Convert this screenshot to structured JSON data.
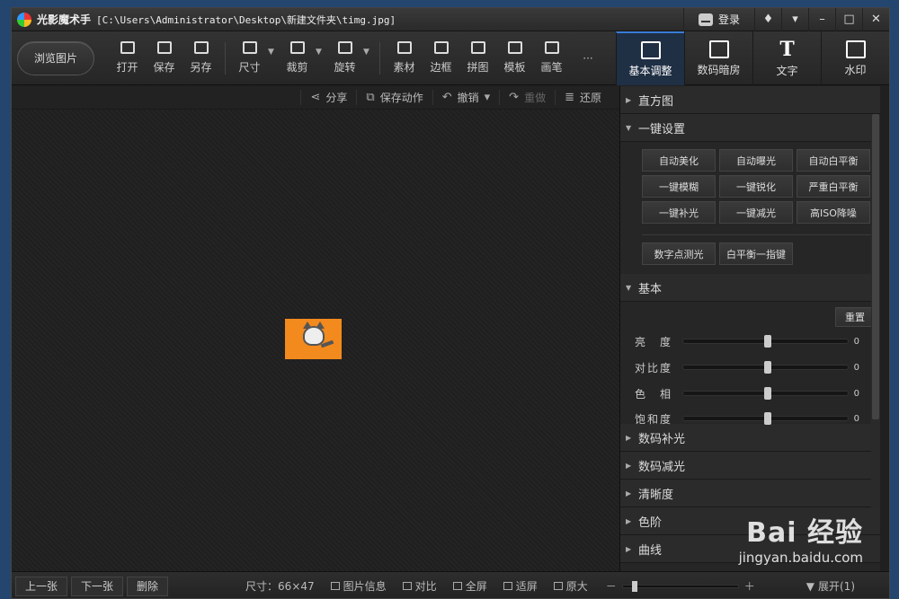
{
  "titlebar": {
    "app_name": "光影魔术手",
    "path": "[C:\\Users\\Administrator\\Desktop\\新建文件夹\\timg.jpg]",
    "login_label": "登录",
    "buttons": [
      "♦",
      "▾",
      "–",
      "□",
      "✕"
    ]
  },
  "toolbar": {
    "browse_label": "浏览图片",
    "tools": [
      {
        "label": "打开",
        "icon": "open-icon"
      },
      {
        "label": "保存",
        "icon": "save-icon"
      },
      {
        "label": "另存",
        "icon": "save-as-icon"
      },
      {
        "label": "尺寸",
        "icon": "resize-icon",
        "dropdown": true
      },
      {
        "label": "裁剪",
        "icon": "crop-icon",
        "dropdown": true
      },
      {
        "label": "旋转",
        "icon": "rotate-icon",
        "dropdown": true
      },
      {
        "label": "素材",
        "icon": "material-icon"
      },
      {
        "label": "边框",
        "icon": "border-icon"
      },
      {
        "label": "拼图",
        "icon": "collage-icon"
      },
      {
        "label": "模板",
        "icon": "template-icon"
      },
      {
        "label": "画笔",
        "icon": "brush-icon"
      }
    ],
    "more_label": "···",
    "right_tabs": [
      {
        "label": "基本调整",
        "icon": "adjust-icon",
        "active": true
      },
      {
        "label": "数码暗房",
        "icon": "camera-icon",
        "active": false
      },
      {
        "label": "文字",
        "icon": "text-icon",
        "glyph": "T",
        "active": false
      },
      {
        "label": "水印",
        "icon": "watermark-icon",
        "active": false
      }
    ]
  },
  "actions": {
    "share": "分享",
    "save_action": "保存动作",
    "undo": "撤销",
    "redo": "重做",
    "restore": "还原"
  },
  "panel": {
    "histogram": "直方图",
    "oneclick": {
      "title": "一键设置",
      "buttons": [
        "自动美化",
        "自动曝光",
        "自动白平衡",
        "一键模糊",
        "一键锐化",
        "严重白平衡",
        "一键补光",
        "一键减光",
        "高ISO降噪"
      ],
      "buttons2": [
        "数字点测光",
        "白平衡一指键"
      ]
    },
    "basic": {
      "title": "基本",
      "reset": "重置",
      "sliders": [
        {
          "label": "亮　度",
          "value": "0"
        },
        {
          "label": "对比度",
          "value": "0"
        },
        {
          "label": "色　相",
          "value": "0"
        },
        {
          "label": "饱和度",
          "value": "0"
        }
      ]
    },
    "collapsed": [
      "数码补光",
      "数码减光",
      "清晰度",
      "色阶",
      "曲线"
    ]
  },
  "statusbar": {
    "prev": "上一张",
    "next": "下一张",
    "delete": "删除",
    "size": "尺寸：66×47",
    "info": "图片信息",
    "compare": "对比",
    "fullscreen": "全屏",
    "fit": "适屏",
    "original": "原大",
    "zoom_minus": "－",
    "zoom_plus": "＋",
    "expand": "展开(1)"
  },
  "watermark": {
    "main": "Bai 经验",
    "sub": "jingyan.baidu.com"
  },
  "colors": {
    "accent": "#3a7bd5",
    "photo_bg": "#f28a1d"
  }
}
